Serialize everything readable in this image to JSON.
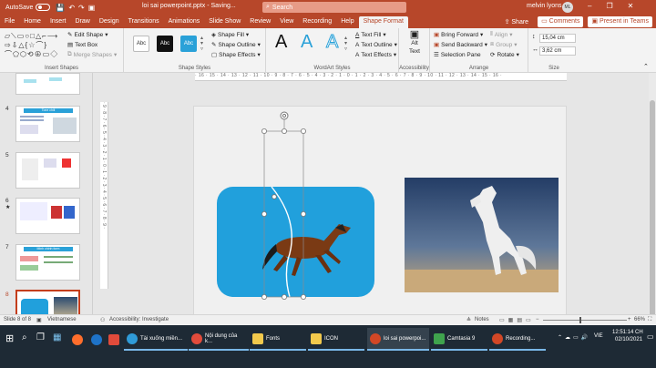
{
  "titlebar": {
    "autosave": "AutoSave",
    "autosave_state": "Off",
    "doc_title": "loi sai powerpoint.pptx  -  Saving...",
    "search_placeholder": "Search",
    "user_name": "melvin lyons",
    "user_initials": "ML"
  },
  "tabs": [
    {
      "label": "File"
    },
    {
      "label": "Home"
    },
    {
      "label": "Insert"
    },
    {
      "label": "Draw"
    },
    {
      "label": "Design"
    },
    {
      "label": "Transitions"
    },
    {
      "label": "Animations"
    },
    {
      "label": "Slide Show"
    },
    {
      "label": "Review"
    },
    {
      "label": "View"
    },
    {
      "label": "Recording"
    },
    {
      "label": "Help"
    },
    {
      "label": "Shape Format",
      "active": true
    }
  ],
  "tab_actions": {
    "share": "Share",
    "comments": "Comments",
    "teams": "Present in Teams"
  },
  "ribbon": {
    "insert_shapes": {
      "label": "Insert Shapes",
      "edit_shape": "Edit Shape",
      "text_box": "Text Box",
      "merge_shapes": "Merge Shapes"
    },
    "shape_styles": {
      "label": "Shape Styles",
      "tiles": [
        "Abc",
        "Abc",
        "Abc"
      ],
      "shape_fill": "Shape Fill",
      "shape_outline": "Shape Outline",
      "shape_effects": "Shape Effects"
    },
    "wordart": {
      "label": "WordArt Styles",
      "letters": [
        "A",
        "A",
        "A"
      ],
      "text_fill": "Text Fill",
      "text_outline": "Text Outline",
      "text_effects": "Text Effects"
    },
    "accessibility": {
      "label": "Accessibility",
      "alt_text_1": "Alt",
      "alt_text_2": "Text"
    },
    "arrange": {
      "label": "Arrange",
      "bring_forward": "Bring Forward",
      "send_backward": "Send Backward",
      "selection_pane": "Selection Pane",
      "align": "Align",
      "group": "Group",
      "rotate": "Rotate"
    },
    "size": {
      "label": "Size",
      "height": "15,04 cm",
      "width": "3,62 cm"
    }
  },
  "thumbnails": [
    {
      "num": "",
      "label": ""
    },
    {
      "num": "4",
      "label": "Tone chill"
    },
    {
      "num": "5",
      "label": ""
    },
    {
      "num": "6",
      "label": ""
    },
    {
      "num": "7",
      "label": "Minh chinh form"
    },
    {
      "num": "8",
      "label": ""
    }
  ],
  "statusbar": {
    "slide_info": "Slide 8 of 8",
    "language": "Vietnamese",
    "accessibility": "Accessibility: Investigate",
    "notes": "Notes",
    "zoom": "66%"
  },
  "taskbar": {
    "items": [
      {
        "label": "",
        "color": "#ff6e2c"
      },
      {
        "label": "",
        "color": "#1e73c8"
      },
      {
        "label": "",
        "color": "#e14b3b"
      },
      {
        "label": "Tài xuống miền...",
        "color": "#2f9bd8",
        "open": true
      },
      {
        "label": "Nội dung của k...",
        "color": "#e14b3b",
        "open": true
      },
      {
        "label": "Fonts",
        "color": "#f2c94c",
        "open": true
      },
      {
        "label": "ICON",
        "color": "#f2c94c",
        "open": true
      },
      {
        "label": "loi sai powerpoi...",
        "color": "#d24726",
        "open": true
      },
      {
        "label": "Camtasia 9",
        "color": "#3fa34d",
        "open": true
      },
      {
        "label": "Recording...",
        "color": "#d24726",
        "open": true
      }
    ],
    "time": "12:51:14 CH",
    "date": "02/10/2021",
    "lang": "VIE"
  }
}
